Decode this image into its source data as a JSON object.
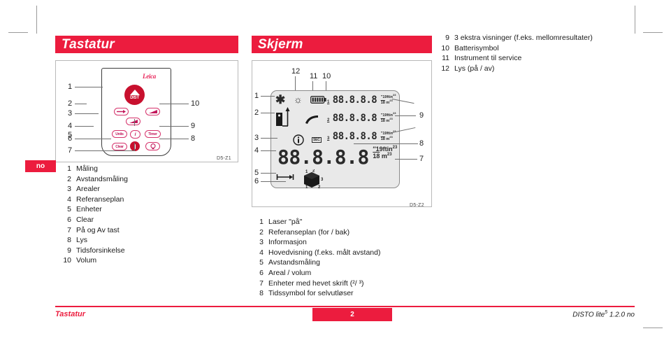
{
  "document": {
    "language_badge": "no",
    "footer": {
      "section": "Tastatur",
      "page_number": "2",
      "product": "DISTO lite",
      "product_sup": "5",
      "version": "1.2.0 no"
    }
  },
  "keypad_section": {
    "title": "Tastatur",
    "figure_caption": "D5-Z1",
    "brand": "Leica",
    "callouts": [
      "1",
      "2",
      "3",
      "4",
      "5",
      "6",
      "7",
      "8",
      "9",
      "10"
    ],
    "keys": {
      "dist": "DIST",
      "units": "Units",
      "info": "i",
      "timer": "Timer",
      "clear": "Clear",
      "light": "light-bulb",
      "power": "power"
    },
    "legend": [
      {
        "n": "1",
        "t": "Måling"
      },
      {
        "n": "2",
        "t": "Avstandsmåling"
      },
      {
        "n": "3",
        "t": "Arealer"
      },
      {
        "n": "4",
        "t": "Referanseplan"
      },
      {
        "n": "5",
        "t": "Enheter"
      },
      {
        "n": "6",
        "t": "Clear"
      },
      {
        "n": "7",
        "t": "På og Av tast"
      },
      {
        "n": "8",
        "t": "Lys"
      },
      {
        "n": "9",
        "t": "Tidsforsinkelse"
      },
      {
        "n": "10",
        "t": "Volum"
      }
    ]
  },
  "display_section": {
    "title": "Skjerm",
    "figure_caption": "D5-Z2",
    "callouts_left": [
      "1",
      "2",
      "3",
      "4",
      "5",
      "6"
    ],
    "callouts_right": [
      "9",
      "8",
      "7"
    ],
    "callouts_top": [
      "12",
      "11",
      "10"
    ],
    "lcd": {
      "digits": "88.8.8.8",
      "small_digits": "88.8.8.8",
      "row_numbers": [
        "1",
        "2",
        "3"
      ],
      "unit_top": "ftin",
      "unit_bottom": "m",
      "unit_sup": "23",
      "frac_top": "19",
      "frac_bottom": "18",
      "sec_label": "SEC",
      "cube_marks": [
        "1",
        "2",
        "3",
        "1",
        "2"
      ]
    },
    "legend": [
      {
        "n": "1",
        "t": "Laser \"på\""
      },
      {
        "n": "2",
        "t": "Referanseplan (for / bak)"
      },
      {
        "n": "3",
        "t": "Informasjon"
      },
      {
        "n": "4",
        "t": "Hovedvisning (f.eks. målt avstand)"
      },
      {
        "n": "5",
        "t": "Avstandsmåling"
      },
      {
        "n": "6",
        "t": "Areal / volum"
      },
      {
        "n": "7",
        "t": "Enheter med hevet skrift (²/ ³)"
      },
      {
        "n": "8",
        "t": "Tidssymbol for selvutløser"
      }
    ]
  },
  "top_right_legend": [
    {
      "n": "9",
      "t": "3 ekstra visninger (f.eks. mellomresultater)"
    },
    {
      "n": "10",
      "t": "Batterisymbol"
    },
    {
      "n": "11",
      "t": "Instrument til service"
    },
    {
      "n": "12",
      "t": "Lys (på / av)"
    }
  ],
  "colors": {
    "brand_red": "#ec1c3e",
    "device_red": "#c8102e",
    "key_pink": "#d6336c"
  }
}
